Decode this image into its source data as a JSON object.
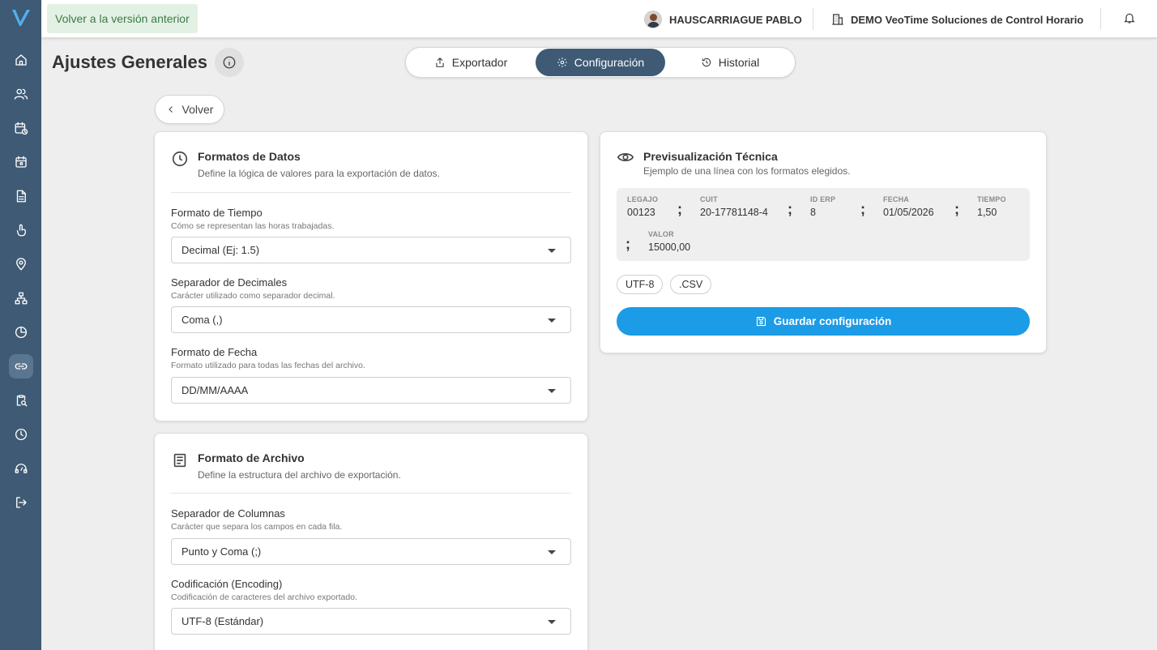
{
  "topbar": {
    "back_label": "Volver a la versión anterior",
    "user_name": "HAUSCARRIAGUE PABLO",
    "company": "DEMO VeoTime Soluciones de Control Horario"
  },
  "page": {
    "title": "Ajustes Generales"
  },
  "tabs": [
    {
      "label": "Exportador",
      "icon": "upload-icon"
    },
    {
      "label": "Configuración",
      "icon": "gear-icon",
      "active": true
    },
    {
      "label": "Historial",
      "icon": "history-icon"
    }
  ],
  "back_button": "Volver",
  "data_formats": {
    "title": "Formatos de Datos",
    "subtitle": "Define la lógica de valores para la exportación de datos.",
    "time_format": {
      "label": "Formato de Tiempo",
      "help": "Cómo se representan las horas trabajadas.",
      "value": "Decimal (Ej: 1.5)"
    },
    "decimal_sep": {
      "label": "Separador de Decimales",
      "help": "Carácter utilizado como separador decimal.",
      "value": "Coma (,)"
    },
    "date_format": {
      "label": "Formato de Fecha",
      "help": "Formato utilizado para todas las fechas del archivo.",
      "value": "DD/MM/AAAA"
    }
  },
  "file_format": {
    "title": "Formato de Archivo",
    "subtitle": "Define la estructura del archivo de exportación.",
    "column_sep": {
      "label": "Separador de Columnas",
      "help": "Carácter que separa los campos en cada fila.",
      "value": "Punto y Coma (;)"
    },
    "encoding": {
      "label": "Codificación (Encoding)",
      "help": "Codificación de caracteres del archivo exportado.",
      "value": "UTF-8 (Estándar)"
    }
  },
  "preview": {
    "title": "Previsualización Técnica",
    "subtitle": "Ejemplo de una línea con los formatos elegidos.",
    "separator": ";",
    "columns": [
      {
        "head": "LEGAJO",
        "value": "00123"
      },
      {
        "head": "CUIT",
        "value": "20-17781148-4"
      },
      {
        "head": "ID ERP",
        "value": "8"
      },
      {
        "head": "FECHA",
        "value": "01/05/2026"
      },
      {
        "head": "TIEMPO",
        "value": "1,50"
      },
      {
        "head": "VALOR",
        "value": "15000,00"
      }
    ],
    "chips": [
      "UTF-8",
      ".CSV"
    ],
    "save_label": "Guardar configuración"
  },
  "colors": {
    "sidebar": "#3f5a74",
    "accent": "#1c9be6",
    "back_old_bg": "#e3f1e5"
  }
}
